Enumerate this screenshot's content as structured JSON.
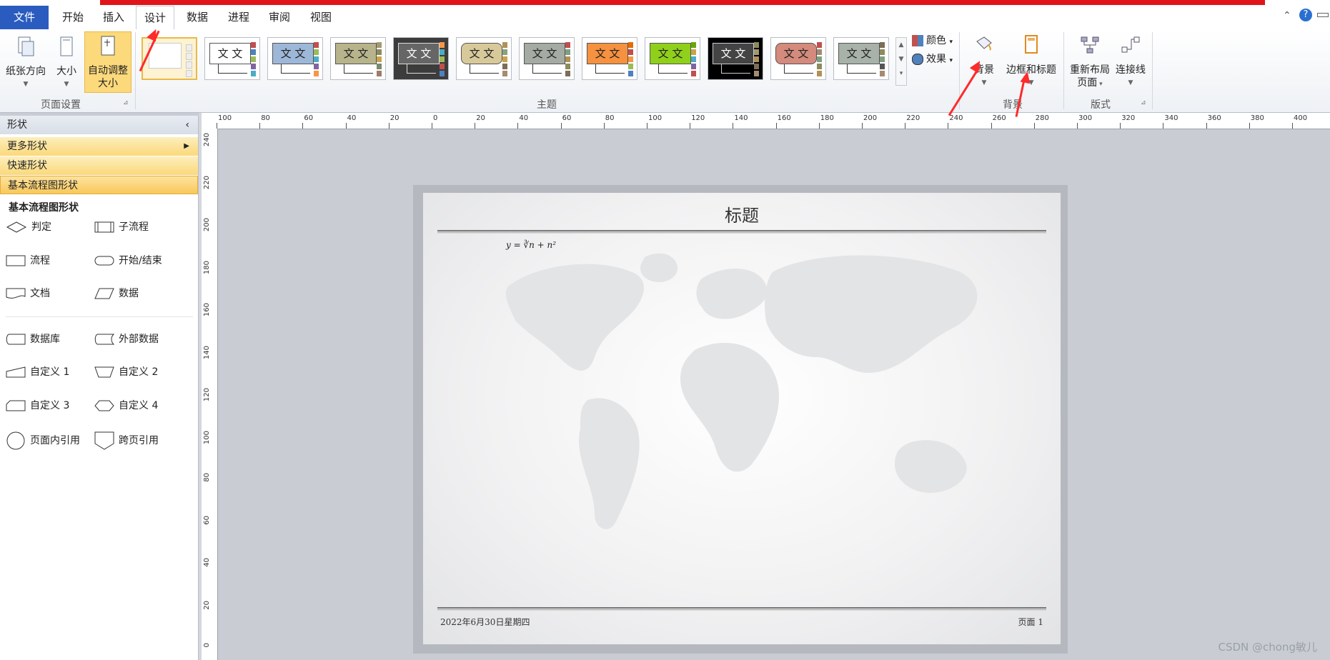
{
  "tabs": [
    {
      "label": "文件"
    },
    {
      "label": "开始"
    },
    {
      "label": "插入"
    },
    {
      "label": "设计"
    },
    {
      "label": "数据"
    },
    {
      "label": "进程"
    },
    {
      "label": "审阅"
    },
    {
      "label": "视图"
    }
  ],
  "active_tab": "设计",
  "ribbon": {
    "page_setup": {
      "label": "页面设置",
      "paper_orientation": "纸张方向",
      "size": "大小",
      "auto_resize_line1": "自动调整",
      "auto_resize_line2": "大小"
    },
    "themes": {
      "label": "主题",
      "sample_text": "文 文",
      "colors": "颜色",
      "effects": "效果"
    },
    "background": {
      "label": "背景",
      "background_btn": "背景",
      "border_title_btn": "边框和标题"
    },
    "layout": {
      "label": "版式",
      "relayout_line1": "重新布局",
      "relayout_line2": "页面",
      "connector": "连接线"
    }
  },
  "shapes_panel": {
    "title": "形状",
    "more_shapes": "更多形状",
    "quick_shapes": "快速形状",
    "basic_flowchart": "基本流程图形状",
    "section_title": "基本流程图形状",
    "shapes": [
      {
        "label": "判定",
        "icon": "diamond-icon"
      },
      {
        "label": "子流程",
        "icon": "subprocess-icon"
      },
      {
        "label": "流程",
        "icon": "rectangle-icon"
      },
      {
        "label": "开始/结束",
        "icon": "terminator-icon"
      },
      {
        "label": "文档",
        "icon": "document-icon"
      },
      {
        "label": "数据",
        "icon": "parallelogram-icon"
      },
      {
        "label": "数据库",
        "icon": "database-icon"
      },
      {
        "label": "外部数据",
        "icon": "external-data-icon"
      },
      {
        "label": "自定义 1",
        "icon": "custom1-icon"
      },
      {
        "label": "自定义 2",
        "icon": "custom2-icon"
      },
      {
        "label": "自定义 3",
        "icon": "custom3-icon"
      },
      {
        "label": "自定义 4",
        "icon": "custom4-icon"
      },
      {
        "label": "页面内引用",
        "icon": "circle-icon"
      },
      {
        "label": "跨页引用",
        "icon": "offpage-icon"
      }
    ]
  },
  "ruler": {
    "h_labels": [
      "100",
      "80",
      "60",
      "40",
      "20",
      "0",
      "20",
      "40",
      "60",
      "80",
      "100",
      "120",
      "140",
      "160",
      "180",
      "200",
      "220",
      "240",
      "260",
      "280",
      "300",
      "320",
      "340",
      "360",
      "380",
      "400"
    ],
    "v_labels": [
      "240",
      "220",
      "200",
      "180",
      "160",
      "140",
      "120",
      "100",
      "80",
      "60",
      "40",
      "20",
      "0"
    ]
  },
  "page": {
    "title": "标题",
    "formula": "y = ∛n + n²",
    "footer_date": "2022年6月30日星期四",
    "footer_page": "页面  1"
  },
  "watermark": "CSDN @chong敏儿",
  "colors": {
    "accent_red": "#e0141a",
    "file_tab": "#2a5bbf",
    "selected": "#fcd97b"
  }
}
